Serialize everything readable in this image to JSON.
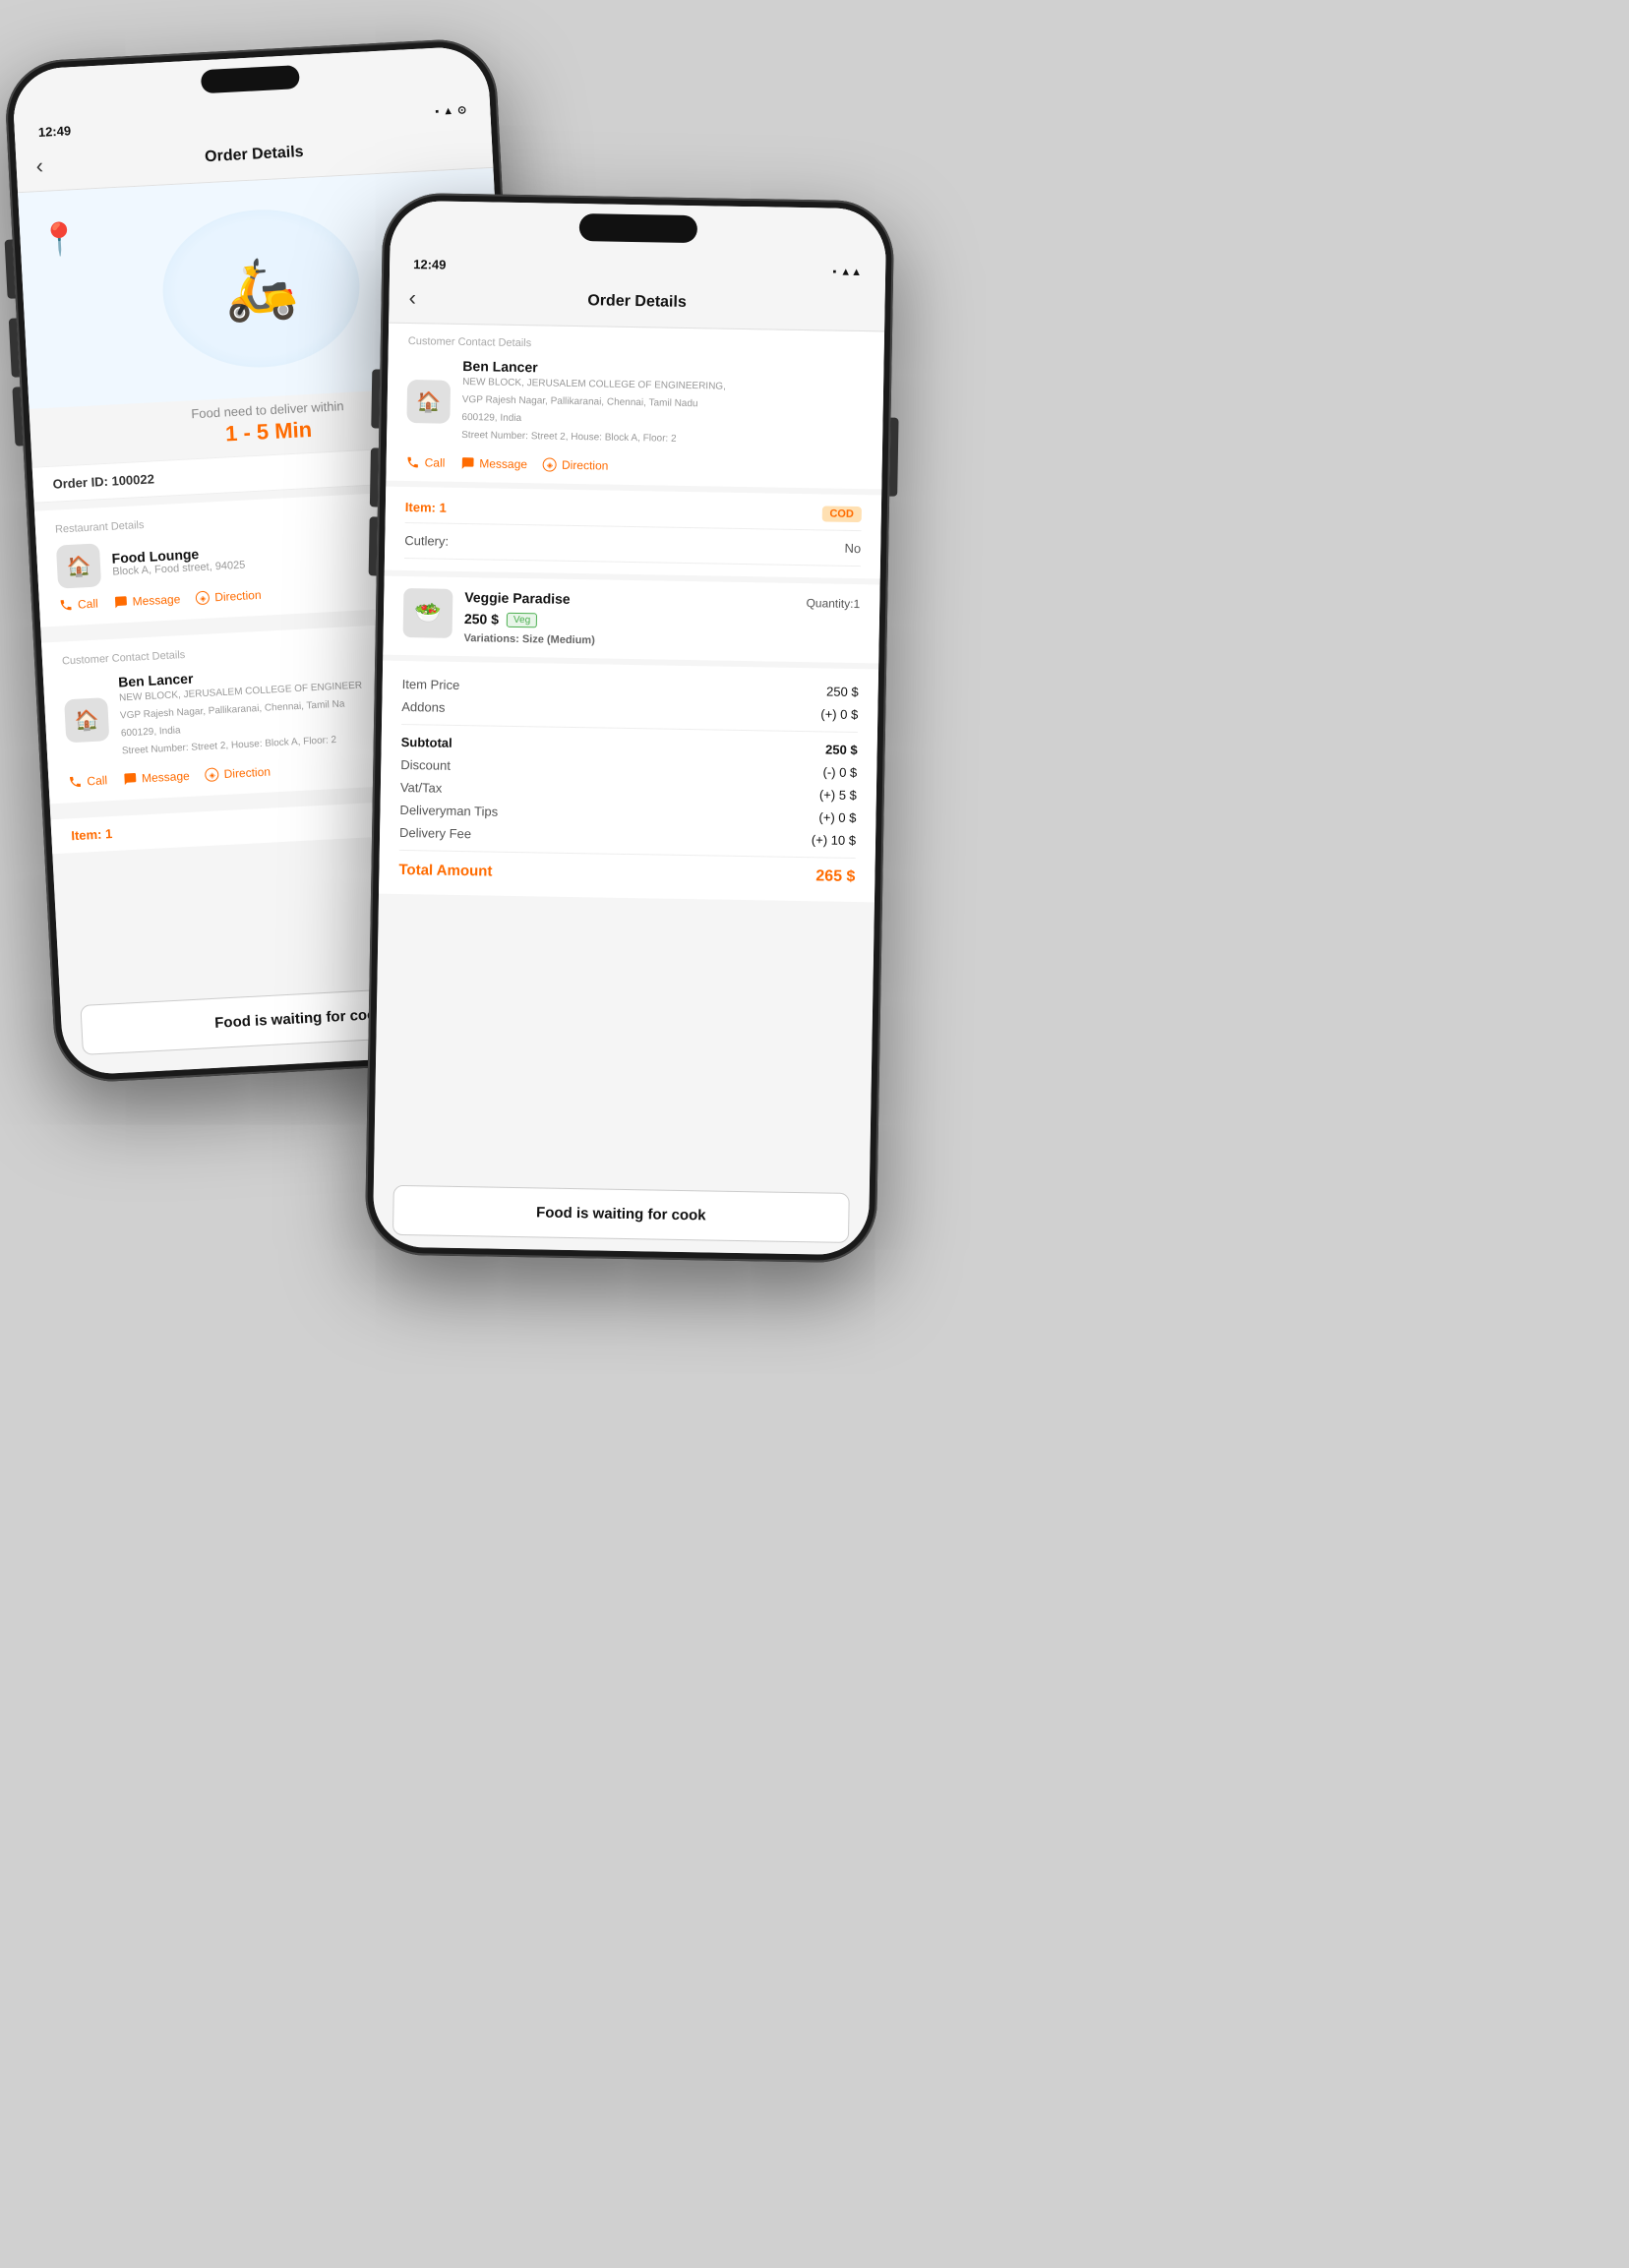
{
  "phone1": {
    "status": {
      "time": "12:49",
      "signal": "▲▲",
      "wifi": "wifi",
      "battery": "A"
    },
    "header": {
      "title": "Order Details",
      "back": "‹"
    },
    "delivery": {
      "label": "Food need to deliver within",
      "time": "1 - 5 Min"
    },
    "order": {
      "id_label": "Order ID:",
      "id_value": "100022",
      "status_color": "#4CAF50"
    },
    "restaurant": {
      "section_label": "Restaurant Details",
      "name": "Food Lounge",
      "address": "Block A, Food street, 94025",
      "call": "Call",
      "message": "Message",
      "direction": "Direction"
    },
    "customer": {
      "section_label": "Customer Contact Details",
      "name": "Ben Lancer",
      "address1": "NEW BLOCK, JERUSALEM COLLEGE OF ENGINEER",
      "address2": "VGP Rajesh Nagar, Pallikaranai, Chennai, Tamil Na",
      "address3": "600129, India",
      "address4": "Street Number: Street 2, House: Block A, Floor: 2",
      "call": "Call",
      "message": "Message",
      "direction": "Direction"
    },
    "items": {
      "label": "Item:",
      "count": "1"
    },
    "bottom_btn": "Food is waiting for cook"
  },
  "phone2": {
    "status": {
      "time": "12:49",
      "signal": "▲▲",
      "battery": "A"
    },
    "header": {
      "title": "Order Details",
      "back": "‹"
    },
    "customer": {
      "section_label": "Customer Contact Details",
      "name": "Ben Lancer",
      "address1": "NEW BLOCK, JERUSALEM COLLEGE OF ENGINEERING,",
      "address2": "VGP Rajesh Nagar, Pallikaranai, Chennai, Tamil Nadu",
      "address3": "600129, India",
      "address4": "Street Number: Street 2, House: Block A, Floor: 2",
      "call": "Call",
      "message": "Message",
      "direction": "Direction"
    },
    "items": {
      "label": "Item:",
      "count": "1",
      "payment": "COD"
    },
    "cutlery": {
      "label": "Cutlery:",
      "value": "No"
    },
    "food_item": {
      "name": "Veggie Paradise",
      "price": "250 $",
      "quantity_label": "Quantity:",
      "quantity": "1",
      "veg_badge": "Veg",
      "variations_label": "Variations:",
      "variations": "Size (Medium)"
    },
    "pricing": {
      "item_price_label": "Item Price",
      "item_price_val": "250 $",
      "addons_label": "Addons",
      "addons_val": "(+) 0 $",
      "subtotal_label": "Subtotal",
      "subtotal_val": "250 $",
      "discount_label": "Discount",
      "discount_val": "(-) 0 $",
      "vat_label": "Vat/Tax",
      "vat_val": "(+) 5 $",
      "tips_label": "Deliveryman Tips",
      "tips_val": "(+) 0 $",
      "delivery_fee_label": "Delivery Fee",
      "delivery_fee_val": "(+) 10 $",
      "total_label": "Total Amount",
      "total_val": "265 $"
    },
    "bottom_btn": "Food is waiting for cook"
  },
  "colors": {
    "orange": "#FF6B00",
    "green": "#4CAF50",
    "light_bg": "#f5f5f5"
  }
}
